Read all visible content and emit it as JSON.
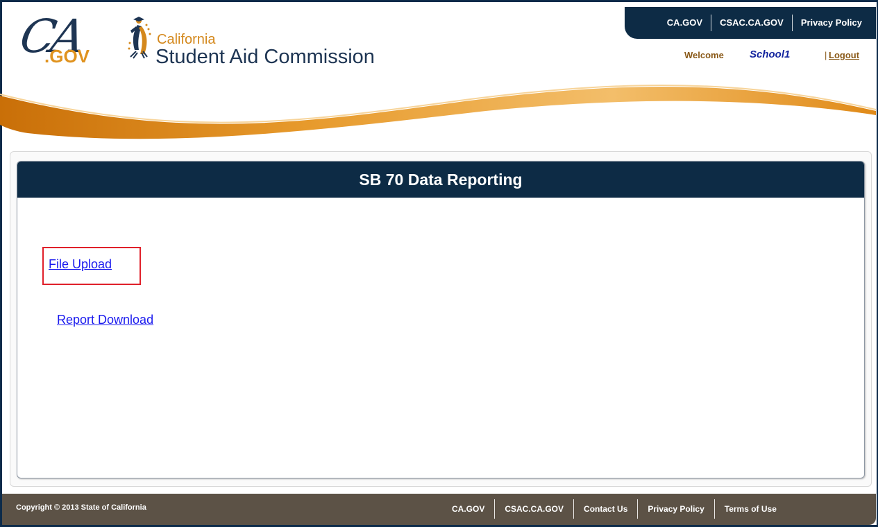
{
  "header": {
    "ca_logo": {
      "script": "CA",
      "suffix": ".GOV"
    },
    "csac_logo": {
      "line1": "California",
      "line2": "Student Aid Commission"
    },
    "top_nav": [
      "CA.GOV",
      "CSAC.CA.GOV",
      "Privacy Policy"
    ],
    "welcome_label": "Welcome",
    "username": "School1",
    "separator": "|",
    "logout_label": "Logout"
  },
  "main": {
    "title": "SB 70 Data Reporting",
    "links": {
      "file_upload": "File Upload",
      "report_download": "Report Download"
    }
  },
  "footer": {
    "copyright": "Copyright © 2013 State of California",
    "nav": [
      "CA.GOV",
      "CSAC.CA.GOV",
      "Contact Us",
      "Privacy Policy",
      "Terms of Use"
    ]
  },
  "colors": {
    "navy": "#0d2b45",
    "gold": "#e0931f",
    "footer": "#5c5246",
    "link": "#1a1aee",
    "highlight": "#e0202a"
  }
}
